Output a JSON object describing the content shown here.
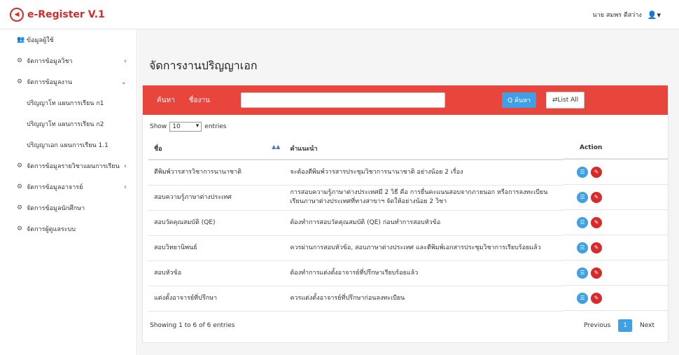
{
  "brand": {
    "title": "e-Register V.1"
  },
  "header": {
    "user_name": "นาย สมพร ดีสว่าง"
  },
  "sidebar": {
    "items": [
      {
        "label": "ข้อมูลผู้ใช้",
        "icon": "users-icon",
        "sub": false,
        "chevron": ""
      },
      {
        "label": "จัดการข้อมูลวิชา",
        "icon": "cogs-icon",
        "sub": false,
        "chevron": "‹"
      },
      {
        "label": "จัดการข้อมูลงาน",
        "icon": "cogs-icon",
        "sub": false,
        "chevron": "⌄"
      },
      {
        "label": "ปริญญาโท แผนการเรียน ก1",
        "icon": "",
        "sub": true,
        "chevron": ""
      },
      {
        "label": "ปริญญาโท แผนการเรียน ก2",
        "icon": "",
        "sub": true,
        "chevron": ""
      },
      {
        "label": "ปริญญาเอก แผนการเรียน 1.1",
        "icon": "",
        "sub": true,
        "chevron": ""
      },
      {
        "label": "จัดการข้อมูลรายวิชาแผนการเรียน",
        "icon": "cogs-icon",
        "sub": false,
        "chevron": "‹"
      },
      {
        "label": "จัดการข้อมูลอาจารย์",
        "icon": "cogs-icon",
        "sub": false,
        "chevron": "‹"
      },
      {
        "label": "จัดการข้อมูลนักศึกษา",
        "icon": "cogs-icon",
        "sub": false,
        "chevron": ""
      },
      {
        "label": "จัดการผู้ดูแลระบบ",
        "icon": "cogs-icon",
        "sub": false,
        "chevron": ""
      }
    ]
  },
  "main": {
    "title": "จัดการงานปริญญาเอก",
    "search": {
      "label": "ค้นหา",
      "field_label": "ชื่องาน",
      "value": "",
      "button": "Q ค้นหา",
      "list_all": "⇄List All"
    },
    "show": {
      "prefix": "Show",
      "value": "10",
      "suffix": "entries"
    },
    "table": {
      "headers": {
        "name": "ชื่อ",
        "desc": "คำแนะนำ",
        "action": "Action"
      },
      "rows": [
        {
          "name": "ตีพิมพ์วารสารวิชาการนานาชาติ",
          "desc": "จะต้องตีพิมพ์วารสารประชุมวิชาการนานาชาติ อย่างน้อย 2 เรื่อง"
        },
        {
          "name": "สอบความรู้ภาษาต่างประเทศ",
          "desc": "การสอบความรู้ภาษาต่างประเทศมี 2 วิธี คือ การยื่นคะแนนสอบจากภายนอก หรือการลงทะเบียนเรียนภาษาต่างประเทศที่ทางสาขาฯ จัดให้อย่างน้อย 2 วิชา"
        },
        {
          "name": "สอบวัดคุณสมบัติ (QE)",
          "desc": "ต้องทำการสอบวัดคุณสมบัติ (QE) ก่อนทำการสอบหัวข้อ"
        },
        {
          "name": "สอบวิทยานิพนธ์",
          "desc": "ควรผ่านการสอบหัวข้อ, สอบภาษาต่างประเทศ และตีพิมพ์เอกสารประชุมวิชาการเรียบร้อยแล้ว"
        },
        {
          "name": "สอบหัวข้อ",
          "desc": "ต้องทำการแต่งตั้งอาจารย์ที่ปรึกษาเรียบร้อยแล้ว"
        },
        {
          "name": "แต่งตั้งอาจารย์ที่ปรึกษา",
          "desc": "ควรแต่งตั้งอาจารย์ที่ปรึกษาก่อนลงทะเบียน"
        }
      ]
    },
    "showing_text": "Showing 1 to 6 of 6 entries",
    "pagination": {
      "previous": "Previous",
      "current": "1",
      "next": "Next"
    }
  },
  "colors": {
    "accent": "#e8463c",
    "brand": "#d62b2b",
    "blue": "#3fa0e6"
  }
}
